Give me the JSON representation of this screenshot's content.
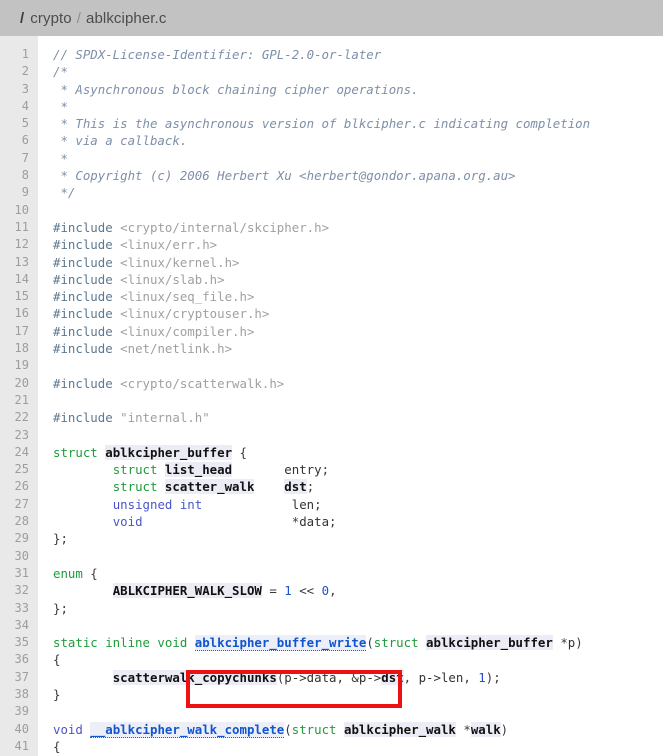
{
  "header": {
    "leading_separator": "/",
    "breadcrumb": [
      {
        "label": "crypto"
      },
      {
        "label": "ablkcipher.c"
      }
    ],
    "separator": "/"
  },
  "editor": {
    "language": "c",
    "first_line": 1,
    "last_visible_line": 41,
    "gutter_color": "#e9e9e9",
    "background_color": "#ffffff",
    "header_color": "#c2c2c2"
  },
  "annotation": {
    "type": "red-rectangle",
    "color": "#ee1111",
    "target_symbol": "ablkcipher_buffer_write",
    "line": 35
  },
  "code": [
    {
      "n": 1,
      "tokens": [
        {
          "t": "cm",
          "v": "// SPDX-License-Identifier: GPL-2.0-or-later"
        }
      ]
    },
    {
      "n": 2,
      "tokens": [
        {
          "t": "cm",
          "v": "/*"
        }
      ]
    },
    {
      "n": 3,
      "tokens": [
        {
          "t": "cm",
          "v": " * Asynchronous block chaining cipher operations."
        }
      ]
    },
    {
      "n": 4,
      "tokens": [
        {
          "t": "cm",
          "v": " *"
        }
      ]
    },
    {
      "n": 5,
      "tokens": [
        {
          "t": "cm",
          "v": " * This is the asynchronous version of blkcipher.c indicating completion"
        }
      ]
    },
    {
      "n": 6,
      "tokens": [
        {
          "t": "cm",
          "v": " * via a callback."
        }
      ]
    },
    {
      "n": 7,
      "tokens": [
        {
          "t": "cm",
          "v": " *"
        }
      ]
    },
    {
      "n": 8,
      "tokens": [
        {
          "t": "cm",
          "v": " * Copyright (c) 2006 Herbert Xu <herbert@gondor.apana.org.au>"
        }
      ]
    },
    {
      "n": 9,
      "tokens": [
        {
          "t": "cm",
          "v": " */"
        }
      ]
    },
    {
      "n": 10,
      "tokens": []
    },
    {
      "n": 11,
      "tokens": [
        {
          "t": "pp",
          "v": "#include"
        },
        {
          "t": "pl",
          "v": " "
        },
        {
          "t": "str",
          "v": "<crypto/internal/skcipher.h>"
        }
      ]
    },
    {
      "n": 12,
      "tokens": [
        {
          "t": "pp",
          "v": "#include"
        },
        {
          "t": "pl",
          "v": " "
        },
        {
          "t": "str",
          "v": "<linux/err.h>"
        }
      ]
    },
    {
      "n": 13,
      "tokens": [
        {
          "t": "pp",
          "v": "#include"
        },
        {
          "t": "pl",
          "v": " "
        },
        {
          "t": "str",
          "v": "<linux/kernel.h>"
        }
      ]
    },
    {
      "n": 14,
      "tokens": [
        {
          "t": "pp",
          "v": "#include"
        },
        {
          "t": "pl",
          "v": " "
        },
        {
          "t": "str",
          "v": "<linux/slab.h>"
        }
      ]
    },
    {
      "n": 15,
      "tokens": [
        {
          "t": "pp",
          "v": "#include"
        },
        {
          "t": "pl",
          "v": " "
        },
        {
          "t": "str",
          "v": "<linux/seq_file.h>"
        }
      ]
    },
    {
      "n": 16,
      "tokens": [
        {
          "t": "pp",
          "v": "#include"
        },
        {
          "t": "pl",
          "v": " "
        },
        {
          "t": "str",
          "v": "<linux/cryptouser.h>"
        }
      ]
    },
    {
      "n": 17,
      "tokens": [
        {
          "t": "pp",
          "v": "#include"
        },
        {
          "t": "pl",
          "v": " "
        },
        {
          "t": "str",
          "v": "<linux/compiler.h>"
        }
      ]
    },
    {
      "n": 18,
      "tokens": [
        {
          "t": "pp",
          "v": "#include"
        },
        {
          "t": "pl",
          "v": " "
        },
        {
          "t": "str",
          "v": "<net/netlink.h>"
        }
      ]
    },
    {
      "n": 19,
      "tokens": []
    },
    {
      "n": 20,
      "tokens": [
        {
          "t": "pp",
          "v": "#include"
        },
        {
          "t": "pl",
          "v": " "
        },
        {
          "t": "str",
          "v": "<crypto/scatterwalk.h>"
        }
      ]
    },
    {
      "n": 21,
      "tokens": []
    },
    {
      "n": 22,
      "tokens": [
        {
          "t": "pp",
          "v": "#include"
        },
        {
          "t": "pl",
          "v": " "
        },
        {
          "t": "str",
          "v": "\"internal.h\""
        }
      ]
    },
    {
      "n": 23,
      "tokens": []
    },
    {
      "n": 24,
      "tokens": [
        {
          "t": "kw",
          "v": "struct"
        },
        {
          "t": "pl",
          "v": " "
        },
        {
          "t": "id",
          "v": "ablkcipher_buffer"
        },
        {
          "t": "pun",
          "v": " {"
        }
      ]
    },
    {
      "n": 25,
      "tokens": [
        {
          "t": "pl",
          "v": "        "
        },
        {
          "t": "kw",
          "v": "struct"
        },
        {
          "t": "pl",
          "v": " "
        },
        {
          "t": "id",
          "v": "list_head"
        },
        {
          "t": "pl",
          "v": "       "
        },
        {
          "t": "pl",
          "v": "entry"
        },
        {
          "t": "pun",
          "v": ";"
        }
      ]
    },
    {
      "n": 26,
      "tokens": [
        {
          "t": "pl",
          "v": "        "
        },
        {
          "t": "kw",
          "v": "struct"
        },
        {
          "t": "pl",
          "v": " "
        },
        {
          "t": "id",
          "v": "scatter_walk"
        },
        {
          "t": "pl",
          "v": "    "
        },
        {
          "t": "id",
          "v": "dst"
        },
        {
          "t": "pun",
          "v": ";"
        }
      ]
    },
    {
      "n": 27,
      "tokens": [
        {
          "t": "pl",
          "v": "        "
        },
        {
          "t": "ty",
          "v": "unsigned int"
        },
        {
          "t": "pl",
          "v": "            "
        },
        {
          "t": "pl",
          "v": "len"
        },
        {
          "t": "pun",
          "v": ";"
        }
      ]
    },
    {
      "n": 28,
      "tokens": [
        {
          "t": "pl",
          "v": "        "
        },
        {
          "t": "ty",
          "v": "void"
        },
        {
          "t": "pl",
          "v": "                    "
        },
        {
          "t": "pun",
          "v": "*"
        },
        {
          "t": "pl",
          "v": "data"
        },
        {
          "t": "pun",
          "v": ";"
        }
      ]
    },
    {
      "n": 29,
      "tokens": [
        {
          "t": "pun",
          "v": "};"
        }
      ]
    },
    {
      "n": 30,
      "tokens": []
    },
    {
      "n": 31,
      "tokens": [
        {
          "t": "kw",
          "v": "enum"
        },
        {
          "t": "pun",
          "v": " {"
        }
      ]
    },
    {
      "n": 32,
      "tokens": [
        {
          "t": "pl",
          "v": "        "
        },
        {
          "t": "id",
          "v": "ABLKCIPHER_WALK_SLOW"
        },
        {
          "t": "pun",
          "v": " = "
        },
        {
          "t": "num",
          "v": "1"
        },
        {
          "t": "pun",
          "v": " << "
        },
        {
          "t": "num",
          "v": "0"
        },
        {
          "t": "pun",
          "v": ","
        }
      ]
    },
    {
      "n": 33,
      "tokens": [
        {
          "t": "pun",
          "v": "};"
        }
      ]
    },
    {
      "n": 34,
      "tokens": []
    },
    {
      "n": 35,
      "tokens": [
        {
          "t": "kw",
          "v": "static inline void"
        },
        {
          "t": "pl",
          "v": " "
        },
        {
          "t": "lnk",
          "v": "ablkcipher_buffer_write"
        },
        {
          "t": "pun",
          "v": "("
        },
        {
          "t": "kw",
          "v": "struct"
        },
        {
          "t": "pl",
          "v": " "
        },
        {
          "t": "id",
          "v": "ablkcipher_buffer"
        },
        {
          "t": "pl",
          "v": " "
        },
        {
          "t": "pun",
          "v": "*"
        },
        {
          "t": "pl",
          "v": "p"
        },
        {
          "t": "pun",
          "v": ")"
        }
      ]
    },
    {
      "n": 36,
      "tokens": [
        {
          "t": "pun",
          "v": "{"
        }
      ]
    },
    {
      "n": 37,
      "tokens": [
        {
          "t": "pl",
          "v": "        "
        },
        {
          "t": "id",
          "v": "scatterwalk_copychunks"
        },
        {
          "t": "pun",
          "v": "("
        },
        {
          "t": "pl",
          "v": "p->data"
        },
        {
          "t": "pun",
          "v": ", &"
        },
        {
          "t": "pl",
          "v": "p->"
        },
        {
          "t": "id",
          "v": "dst"
        },
        {
          "t": "pun",
          "v": ", "
        },
        {
          "t": "pl",
          "v": "p->len"
        },
        {
          "t": "pun",
          "v": ", "
        },
        {
          "t": "num",
          "v": "1"
        },
        {
          "t": "pun",
          "v": ");"
        }
      ]
    },
    {
      "n": 38,
      "tokens": [
        {
          "t": "pun",
          "v": "}"
        }
      ]
    },
    {
      "n": 39,
      "tokens": []
    },
    {
      "n": 40,
      "tokens": [
        {
          "t": "ty",
          "v": "void"
        },
        {
          "t": "pl",
          "v": " "
        },
        {
          "t": "lnk",
          "v": "__ablkcipher_walk_complete"
        },
        {
          "t": "pun",
          "v": "("
        },
        {
          "t": "kw",
          "v": "struct"
        },
        {
          "t": "pl",
          "v": " "
        },
        {
          "t": "id",
          "v": "ablkcipher_walk"
        },
        {
          "t": "pl",
          "v": " "
        },
        {
          "t": "pun",
          "v": "*"
        },
        {
          "t": "id",
          "v": "walk"
        },
        {
          "t": "pun",
          "v": ")"
        }
      ]
    },
    {
      "n": 41,
      "tokens": [
        {
          "t": "pun",
          "v": "{"
        }
      ]
    }
  ]
}
